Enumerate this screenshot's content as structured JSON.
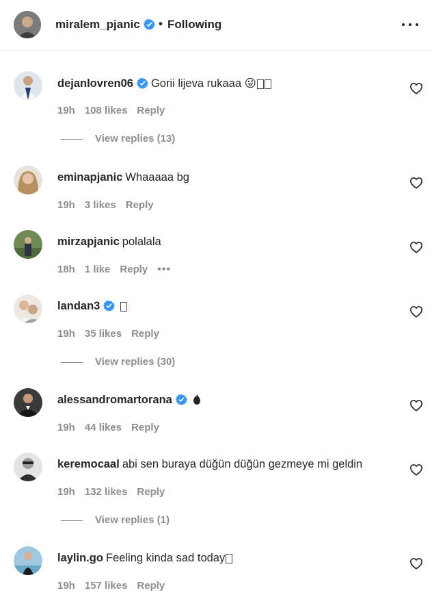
{
  "header": {
    "username": "miralem_pjanic",
    "separator": "•",
    "follow_status": "Following"
  },
  "colors": {
    "verified": "#3897f0",
    "text": "#262626",
    "muted": "#8e8e8e"
  },
  "comments": [
    {
      "username": "dejanlovren06",
      "verified": true,
      "text": "Gorii lijeva rukaaa 😜",
      "time": "19h",
      "likes": "108 likes",
      "reply": "Reply",
      "view_replies": "View replies (13)"
    },
    {
      "username": "eminapjanic",
      "verified": false,
      "text": "Whaaaaa bg",
      "time": "19h",
      "likes": "3 likes",
      "reply": "Reply"
    },
    {
      "username": "mirzapjanic",
      "verified": false,
      "text": "polalala",
      "time": "18h",
      "likes": "1 like",
      "reply": "Reply",
      "more": "•••"
    },
    {
      "username": "landan3",
      "verified": true,
      "text": "",
      "time": "19h",
      "likes": "35 likes",
      "reply": "Reply",
      "view_replies": "View replies (30)"
    },
    {
      "username": "alessandromartorana",
      "verified": true,
      "text": "",
      "time": "19h",
      "likes": "44 likes",
      "reply": "Reply"
    },
    {
      "username": "keremocaal",
      "verified": false,
      "text": "abi sen buraya düğün düğün gezmeye mi geldin",
      "time": "19h",
      "likes": "132 likes",
      "reply": "Reply",
      "view_replies": "View replies (1)"
    },
    {
      "username": "laylin.go",
      "verified": false,
      "text": "Feeling kinda sad today",
      "time": "19h",
      "likes": "157 likes",
      "reply": "Reply"
    }
  ]
}
